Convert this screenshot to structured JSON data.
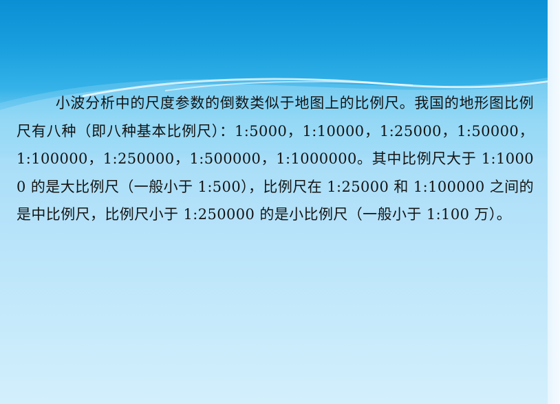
{
  "slide": {
    "paragraph": "小波分析中的尺度参数的倒数类似于地图上的比例尺。我国的地形图比例尺有八种（即八种基本比例尺）：1:5000，1:10000，1:25000，1:50000，1:100000，1:250000，1:500000，1:1000000。其中比例尺大于 1:10000 的是大比例尺（一般小于 1:500），比例尺在 1:25000 和 1:100000 之间的是中比例尺，比例尺小于 1:250000 的是小比例尺（一般小于 1:100 万）。"
  },
  "colors": {
    "header_blue": "#0a8fd4",
    "background_light": "#c6eafb",
    "text": "#141414"
  }
}
